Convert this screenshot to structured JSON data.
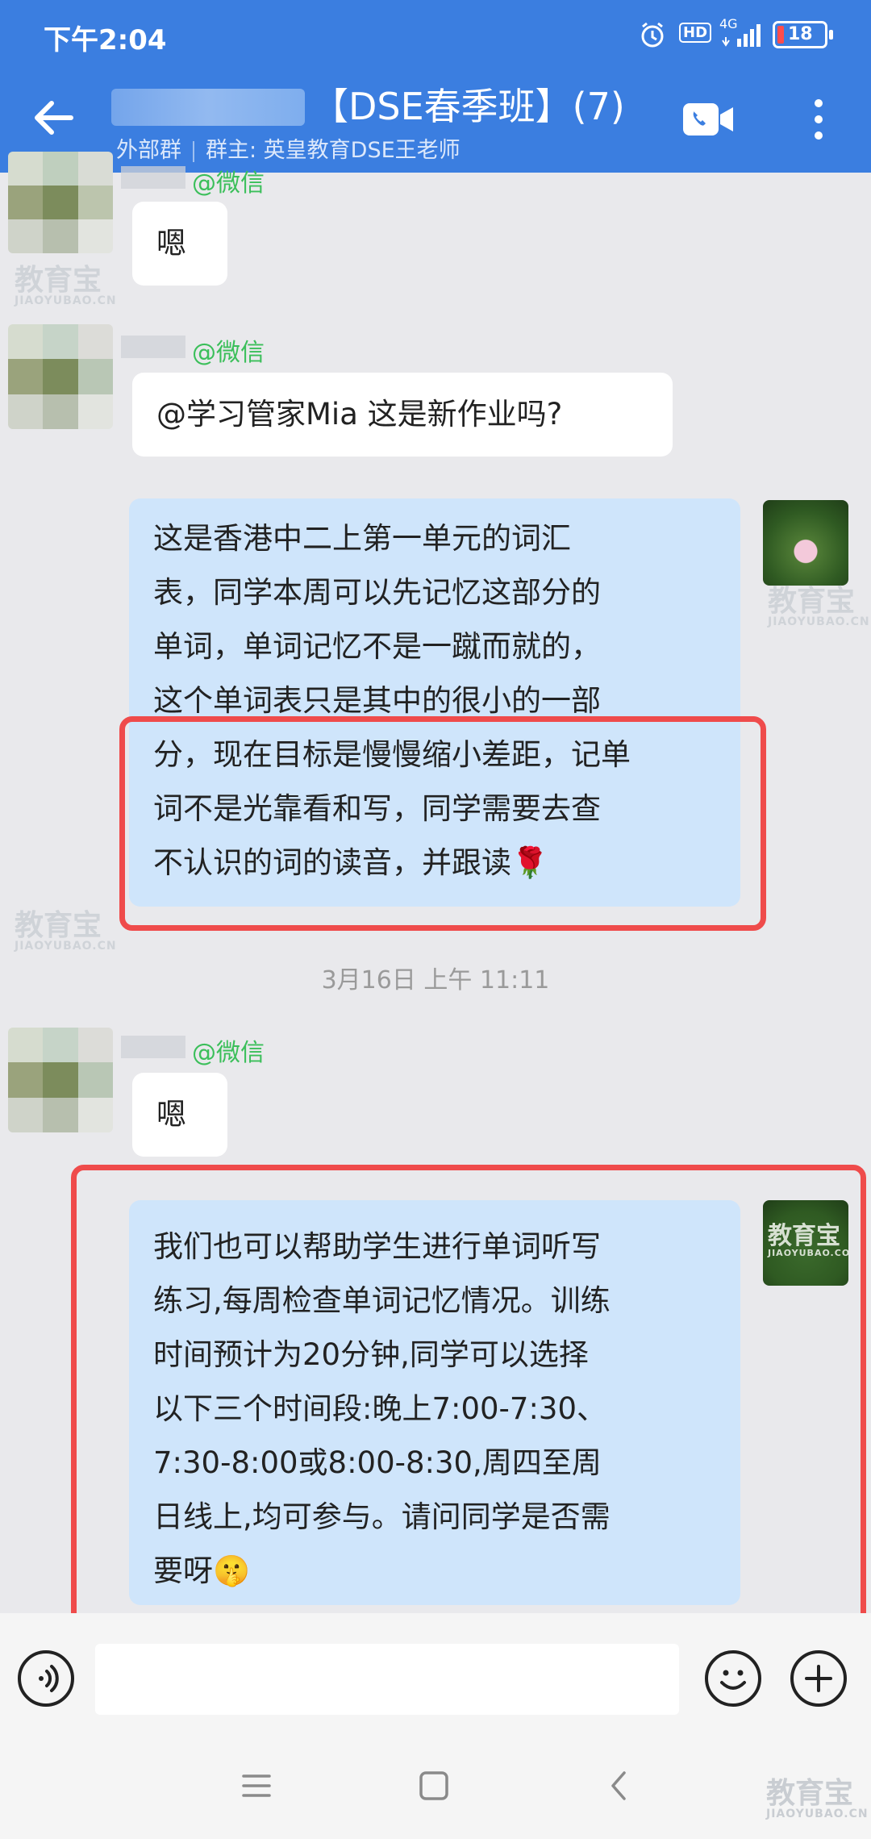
{
  "status_bar": {
    "time": "下午2:04",
    "network": "4G",
    "hd": "HD",
    "battery": "18"
  },
  "header": {
    "title": "【DSE春季班】(7)",
    "subtitle_group_type": "外部群",
    "subtitle_owner": "群主: 英皇教育DSE王老师"
  },
  "messages": [
    {
      "source": "@微信",
      "text": "嗯"
    },
    {
      "source": "@微信",
      "text": "@学习管家Mia 这是新作业吗?"
    },
    {
      "lines": [
        "这是香港中二上第一单元的词汇",
        "表，同学本周可以先记忆这部分的",
        "单词，单词记忆不是一蹴而就的，",
        "这个单词表只是其中的很小的一部",
        "分，现在目标是慢慢缩小差距，记单",
        "词不是光靠看和写，同学需要去查",
        "不认识的词的读音，并跟读"
      ],
      "emoji": "🌹"
    },
    {
      "timestamp": "3月16日 上午 11:11"
    },
    {
      "source": "@微信",
      "text": "嗯"
    },
    {
      "lines": [
        "我们也可以帮助学生进行单词听写",
        "练习,每周检查单词记忆情况。训练",
        "时间预计为20分钟,同学可以选择",
        "以下三个时间段:晚上7:00-7:30、",
        "7:30-8:00或8:00-8:30,周四至周",
        "日线上,均可参与。请问同学是否需",
        "要呀"
      ],
      "emoji": "🤫"
    }
  ],
  "watermark": {
    "cn": "教育宝",
    "en": "JIAOYUBAO.CN",
    "en2": "JIAOYUBAO.COM"
  },
  "colors": {
    "header": "#3b7ee0",
    "bubble_outgoing": "#cfe5fb",
    "bubble_incoming": "#ffffff",
    "highlight": "#ef4b4b",
    "sender_tag": "#3bbf5a"
  },
  "icons": [
    "back-arrow-icon",
    "video-call-icon",
    "more-icon",
    "voice-icon",
    "emoji-icon",
    "plus-icon",
    "menu-icon",
    "home-icon",
    "back-nav-icon"
  ]
}
